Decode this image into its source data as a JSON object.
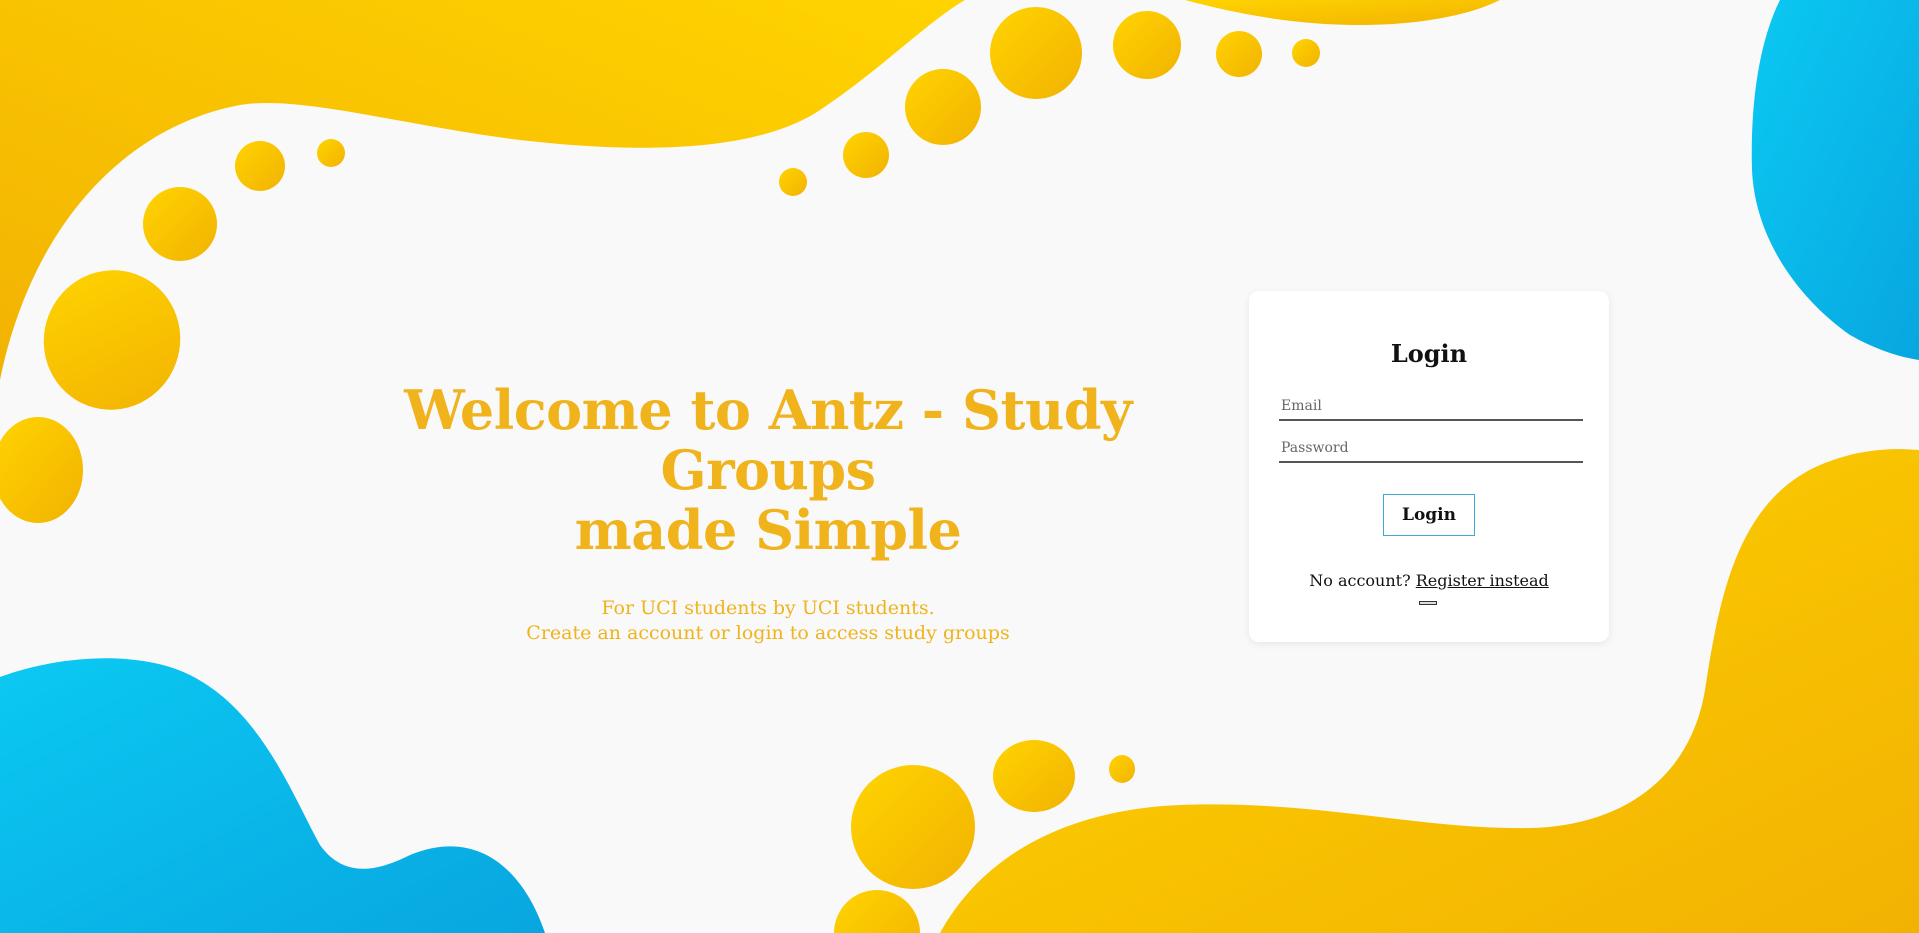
{
  "hero": {
    "title_line1": "Welcome to Antz - Study Groups",
    "title_line2": "made Simple",
    "subtitle_line1": "For UCI students by UCI students.",
    "subtitle_line2": "Create an account or login to access study groups"
  },
  "login_card": {
    "title": "Login",
    "email_placeholder": "Email",
    "email_value": "",
    "password_placeholder": "Password",
    "password_value": "",
    "login_button": "Login",
    "no_account_text": "No account?",
    "register_link": "Register instead"
  },
  "colors": {
    "accent_yellow": "#f5b800",
    "accent_blue": "#0ac4ee",
    "hero_text": "#f0b31c",
    "background": "#f9f9f9"
  }
}
